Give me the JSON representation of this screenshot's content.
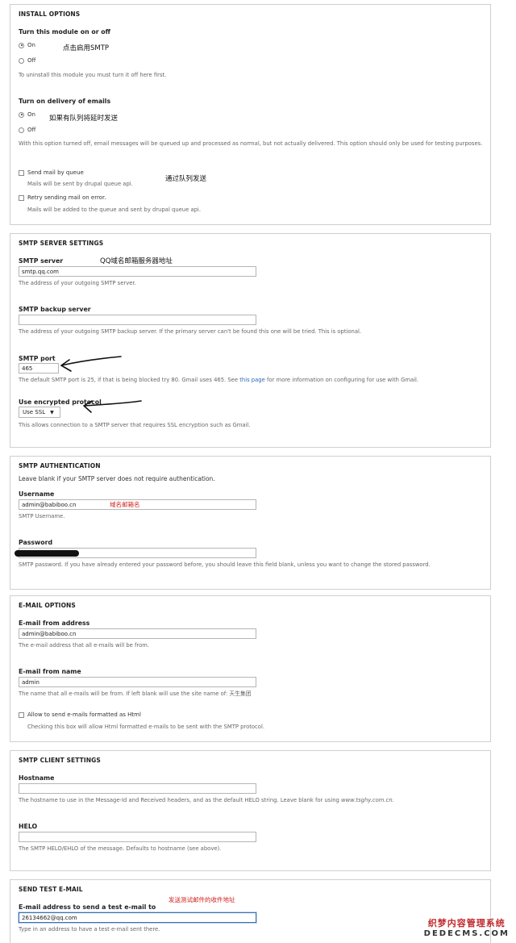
{
  "install": {
    "legend": "INSTALL OPTIONS",
    "module_label": "Turn this module on or off",
    "module_on": "On",
    "module_off": "Off",
    "module_desc": "To uninstall this module you must turn it off here first.",
    "module_annot": "点击启用SMTP",
    "delivery_label": "Turn on delivery of emails",
    "delivery_on": "On",
    "delivery_off": "Off",
    "delivery_annot": "如果有队列将延时发送",
    "delivery_desc": "With this option turned off, email messages will be queued up and processed as normal, but not actually delivered. This option should only be used for testing purposes.",
    "queue_label": "Send mail by queue",
    "queue_desc": "Mails will be sent by drupal queue api.",
    "queue_annot": "通过队列发送",
    "retry_label": "Retry sending mail on error.",
    "retry_desc": "Mails will be added to the queue and sent by drupal queue api."
  },
  "server": {
    "legend": "SMTP SERVER SETTINGS",
    "server_label": "SMTP server",
    "server_annot": "QQ域名邮箱服务器地址",
    "server_value": "smtp.qq.com",
    "server_desc": "The address of your outgoing SMTP server.",
    "backup_label": "SMTP backup server",
    "backup_value": "",
    "backup_desc": "The address of your outgoing SMTP backup server. If the primary server can't be found this one will be tried. This is optional.",
    "port_label": "SMTP port",
    "port_value": "465",
    "port_desc_pre": "The default SMTP port is 25, if that is being blocked try 80. Gmail uses 465. See",
    "port_desc_link": "this page",
    "port_desc_post": "for more information on configuring for use with Gmail.",
    "protocol_label": "Use encrypted protocol",
    "protocol_value": "Use SSL",
    "protocol_desc": "This allows connection to a SMTP server that requires SSL encryption such as Gmail."
  },
  "auth": {
    "legend": "SMTP AUTHENTICATION",
    "intro": "Leave blank if your SMTP server does not require authentication.",
    "username_label": "Username",
    "username_value": "admin@babiboo.cn",
    "username_annot": "域名邮箱名",
    "username_desc": "SMTP Username.",
    "password_label": "Password",
    "password_desc": "SMTP password. If you have already entered your password before, you should leave this field blank, unless you want to change the stored password."
  },
  "email": {
    "legend": "E-MAIL OPTIONS",
    "from_address_label": "E-mail from address",
    "from_address_value": "admin@babiboo.cn",
    "from_address_desc": "The e-mail address that all e-mails will be from.",
    "from_name_label": "E-mail from name",
    "from_name_value": "admin",
    "from_name_desc": "The name that all e-mails will be from. If left blank will use the site name of: 天生集团",
    "html_label": "Allow to send e-mails formatted as Html",
    "html_desc": "Checking this box will allow Html formatted e-mails to be sent with the SMTP protocol."
  },
  "client": {
    "legend": "SMTP CLIENT SETTINGS",
    "hostname_label": "Hostname",
    "hostname_value": "",
    "hostname_desc_pre": "The hostname to use in the Message-Id and Received headers, and as the default HELO string. Leave blank for using",
    "hostname_desc_em": "www.tsghy.com.cn.",
    "helo_label": "HELO",
    "helo_value": "",
    "helo_desc": "The SMTP HELO/EHLO of the message. Defaults to hostname (see above)."
  },
  "test": {
    "legend": "SEND TEST E-MAIL",
    "to_label": "E-mail address to send a test e-mail to",
    "to_annot": "发送测试邮件的收件地址",
    "to_value": "26134662@qq.com",
    "to_desc": "Type in an address to have a test e-mail sent there."
  },
  "watermark": {
    "top": "织梦内容管理系统",
    "bottom": "DEDECMS.COM"
  }
}
